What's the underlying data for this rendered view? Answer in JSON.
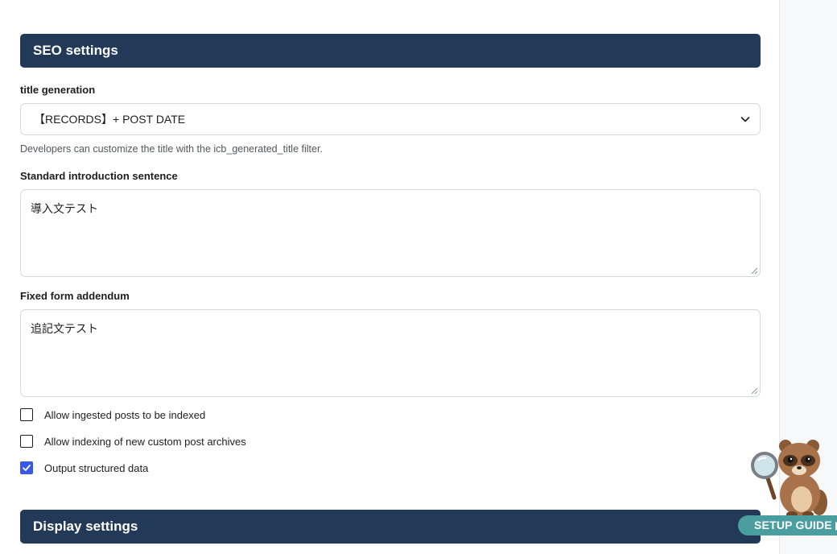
{
  "seo_section": {
    "title": "SEO settings"
  },
  "title_generation": {
    "label": "title generation",
    "selected": "【RECORDS】+ POST DATE",
    "help": "Developers can customize the title with the icb_generated_title filter."
  },
  "intro_sentence": {
    "label": "Standard introduction sentence",
    "value": "導入文テスト"
  },
  "addendum": {
    "label": "Fixed form addendum",
    "value": "追記文テスト"
  },
  "checkboxes": [
    {
      "label": "Allow ingested posts to be indexed",
      "checked": false
    },
    {
      "label": "Allow indexing of new custom post archives",
      "checked": false
    },
    {
      "label": "Output structured data",
      "checked": true
    }
  ],
  "display_section": {
    "title": "Display settings"
  },
  "setup_guide": {
    "label": "SETUP GUIDE ▶"
  },
  "colors": {
    "header_bg": "#223a57",
    "checkbox_accent": "#3858e9",
    "guide_bg": "#4a9ea0"
  },
  "icons": {
    "select_arrow": "chevron-down-icon",
    "resize": "resize-handle-icon",
    "check": "checkmark-icon",
    "mascot": "raccoon-magnifier-mascot"
  }
}
